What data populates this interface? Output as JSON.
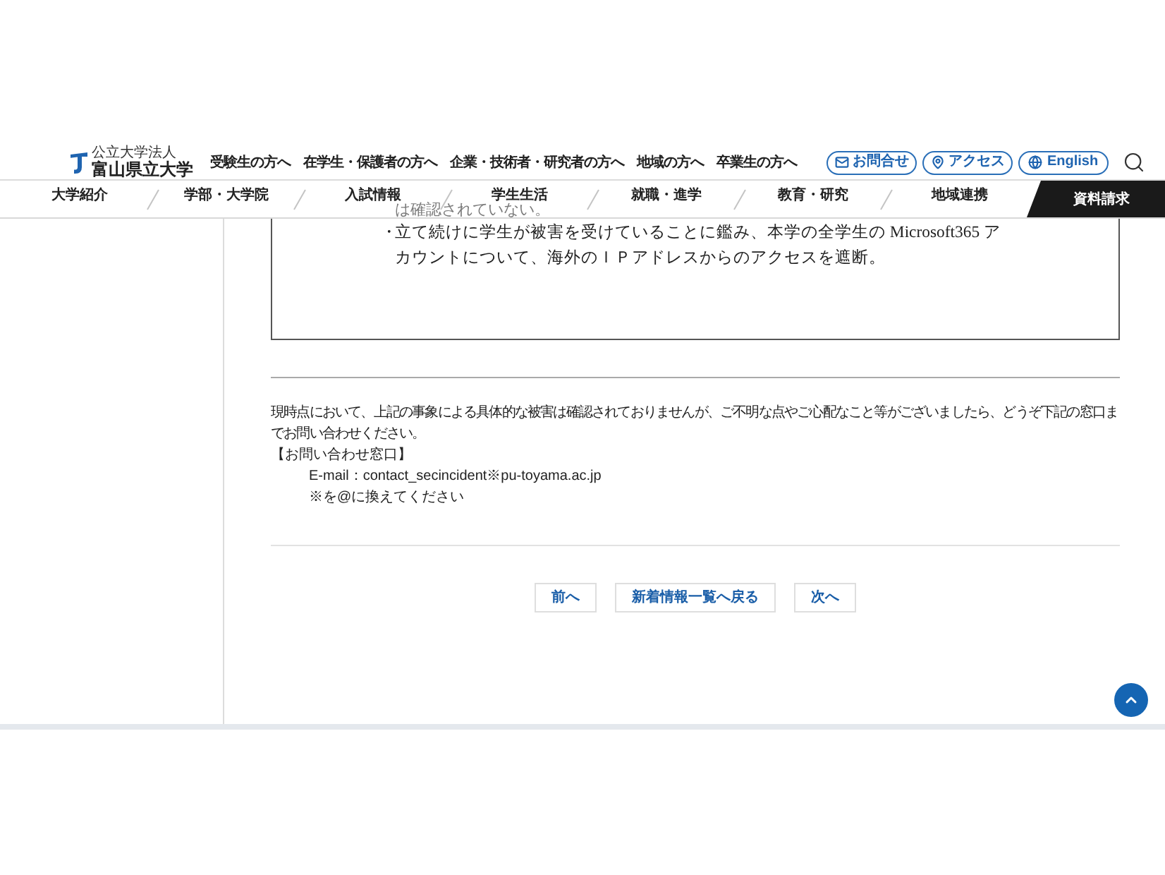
{
  "header": {
    "logo": {
      "subtitle": "公立大学法人",
      "name": "富山県立大学"
    },
    "audience_links": [
      "受験生の方へ",
      "在学生・保護者の方へ",
      "企業・技術者・研究者の方へ",
      "地域の方へ",
      "卒業生の方へ"
    ],
    "pill_buttons": [
      {
        "kind": "mail",
        "label": "お問合せ"
      },
      {
        "kind": "pin",
        "label": "アクセス"
      },
      {
        "kind": "globe",
        "label": "English"
      }
    ]
  },
  "main_nav": {
    "items": [
      {
        "kind": "link",
        "label": "大学紹介"
      },
      {
        "kind": "link",
        "label": "学部・大学院"
      },
      {
        "kind": "link",
        "label": "入試情報"
      },
      {
        "kind": "link",
        "label": "学生生活"
      },
      {
        "kind": "link",
        "label": "就職・進学"
      },
      {
        "kind": "link",
        "label": "教育・研究"
      },
      {
        "kind": "link",
        "label": "地域連携"
      },
      {
        "kind": "cta",
        "label": "資料請求"
      }
    ]
  },
  "notice_box": {
    "partially_hidden_item": {
      "text": "は確認されていない。"
    },
    "items": [
      {
        "bullet": "・",
        "lines": [
          "立て続けに学生が被害を受けていることに鑑み、本学の全学生の Microsoft365 ア",
          "カウントについて、海外のＩＰアドレスからのアクセスを遮断。"
        ]
      }
    ]
  },
  "notice": {
    "paragraph_lines": [
      "現時点において、上記の事象による具体的な被害は確認されておりませんが、ご不明な点やご心配なこと等がございましたら、どうぞ下記の窓口ま",
      "でお問い合わせください。"
    ],
    "contact_heading": "【お問い合わせ窓口】",
    "email": "E-mail：contact_secincident※pu-toyama.ac.jp",
    "note": "※を@に換えてください"
  },
  "pager": [
    "前へ",
    "新着情報一覧へ戻る",
    "次へ"
  ]
}
